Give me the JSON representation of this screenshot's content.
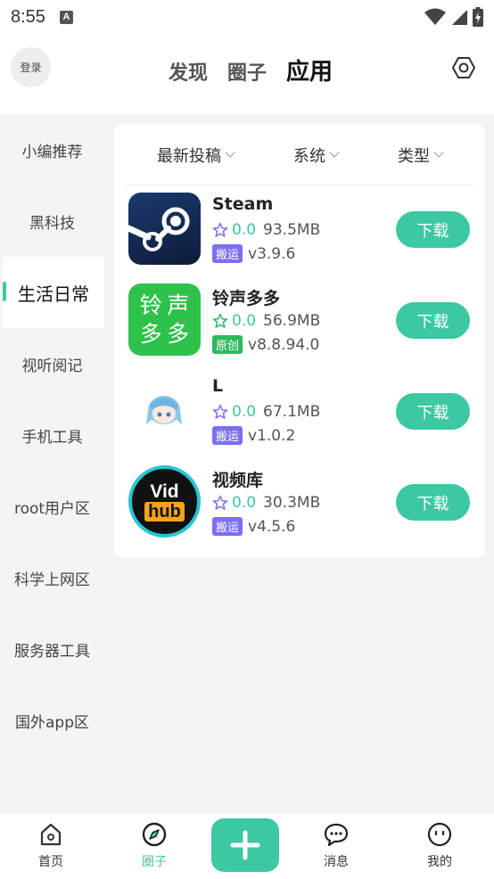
{
  "status": {
    "time": "8:55",
    "notif_glyph": "A"
  },
  "header": {
    "login_label": "登录",
    "tabs": [
      {
        "label": "发现"
      },
      {
        "label": "圈子"
      },
      {
        "label": "应用",
        "active": true
      }
    ]
  },
  "sidebar": {
    "items": [
      {
        "label": "小编推荐"
      },
      {
        "label": "黑科技"
      },
      {
        "label": "生活日常",
        "active": true
      },
      {
        "label": "视听阅记"
      },
      {
        "label": "手机工具"
      },
      {
        "label": "root用户区"
      },
      {
        "label": "科学上网区"
      },
      {
        "label": "服务器工具"
      },
      {
        "label": "国外app区"
      }
    ]
  },
  "filters": [
    {
      "label": "最新投稿"
    },
    {
      "label": "系统"
    },
    {
      "label": "类型"
    }
  ],
  "apps": [
    {
      "name": "Steam",
      "rating": "0.0",
      "size": "93.5MB",
      "tag": "搬运",
      "tag_color": "#7b6ff0",
      "version": "v3.9.6",
      "download_label": "下载",
      "icon": "steam-icon"
    },
    {
      "name": "铃声多多",
      "rating": "0.0",
      "size": "56.9MB",
      "tag": "原创",
      "tag_color": "#2db85f",
      "version": "v8.8.94.0",
      "download_label": "下载",
      "icon": "ringtone-icon",
      "icon_text": [
        "铃",
        "声",
        "多",
        "多"
      ]
    },
    {
      "name": "L",
      "rating": "0.0",
      "size": "67.1MB",
      "tag": "搬运",
      "tag_color": "#7b6ff0",
      "version": "v1.0.2",
      "download_label": "下载",
      "icon": "anime-girl-icon"
    },
    {
      "name": "视频库",
      "rating": "0.0",
      "size": "30.3MB",
      "tag": "搬运",
      "tag_color": "#7b6ff0",
      "version": "v4.5.6",
      "download_label": "下载",
      "icon": "vidhub-icon",
      "icon_text": [
        "Vid",
        "hub"
      ]
    }
  ],
  "bottom_nav": [
    {
      "label": "首页",
      "icon": "home-icon"
    },
    {
      "label": "圈子",
      "icon": "compass-icon",
      "active": true
    },
    {
      "label": "",
      "icon": "plus-icon"
    },
    {
      "label": "消息",
      "icon": "chat-icon"
    },
    {
      "label": "我的",
      "icon": "face-icon"
    }
  ],
  "colors": {
    "accent": "#3cc8a0",
    "tag_purple": "#7b6ff0",
    "tag_green": "#2db85f"
  }
}
